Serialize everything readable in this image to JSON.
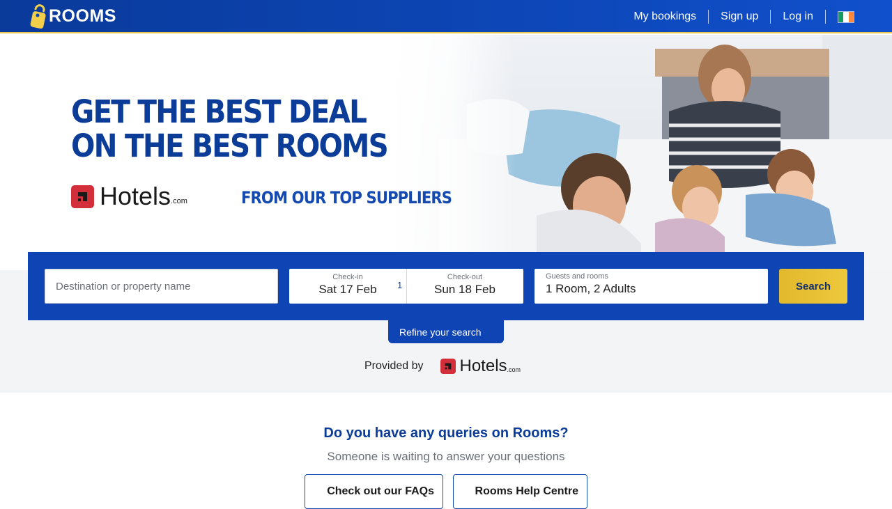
{
  "header": {
    "brand": "ROOMS",
    "nav": {
      "my_bookings": "My bookings",
      "sign_up": "Sign up",
      "log_in": "Log in"
    },
    "flag_colors": [
      "#169b62",
      "#ffffff",
      "#ff883e"
    ]
  },
  "hero": {
    "headline_line1": "GET THE BEST DEAL",
    "headline_line2": "ON THE BEST ROOMS",
    "partner_logo_text": "Hotels",
    "partner_logo_suffix": ".com",
    "tagline": "FROM OUR TOP SUPPLIERS"
  },
  "search": {
    "destination_placeholder": "Destination or property name",
    "checkin_label": "Check-in",
    "checkin_value": "Sat 17 Feb",
    "nights": "1",
    "checkout_label": "Check-out",
    "checkout_value": "Sun 18 Feb",
    "guests_label": "Guests and rooms",
    "guests_value": "1 Room, 2 Adults",
    "search_button": "Search"
  },
  "refine": {
    "label": "Refine your search"
  },
  "provided": {
    "label": "Provided by",
    "logo_text": "Hotels",
    "logo_suffix": ".com"
  },
  "queries": {
    "title": "Do you have any queries on Rooms?",
    "subtitle": "Someone is waiting to answer your questions",
    "faq_button": "Check out our FAQs",
    "help_button": "Rooms Help Centre"
  },
  "colors": {
    "brand_blue": "#0e44b4",
    "headline_blue": "#0b3c98",
    "accent_yellow": "#e8c94a",
    "hotels_red": "#d32f3a"
  }
}
